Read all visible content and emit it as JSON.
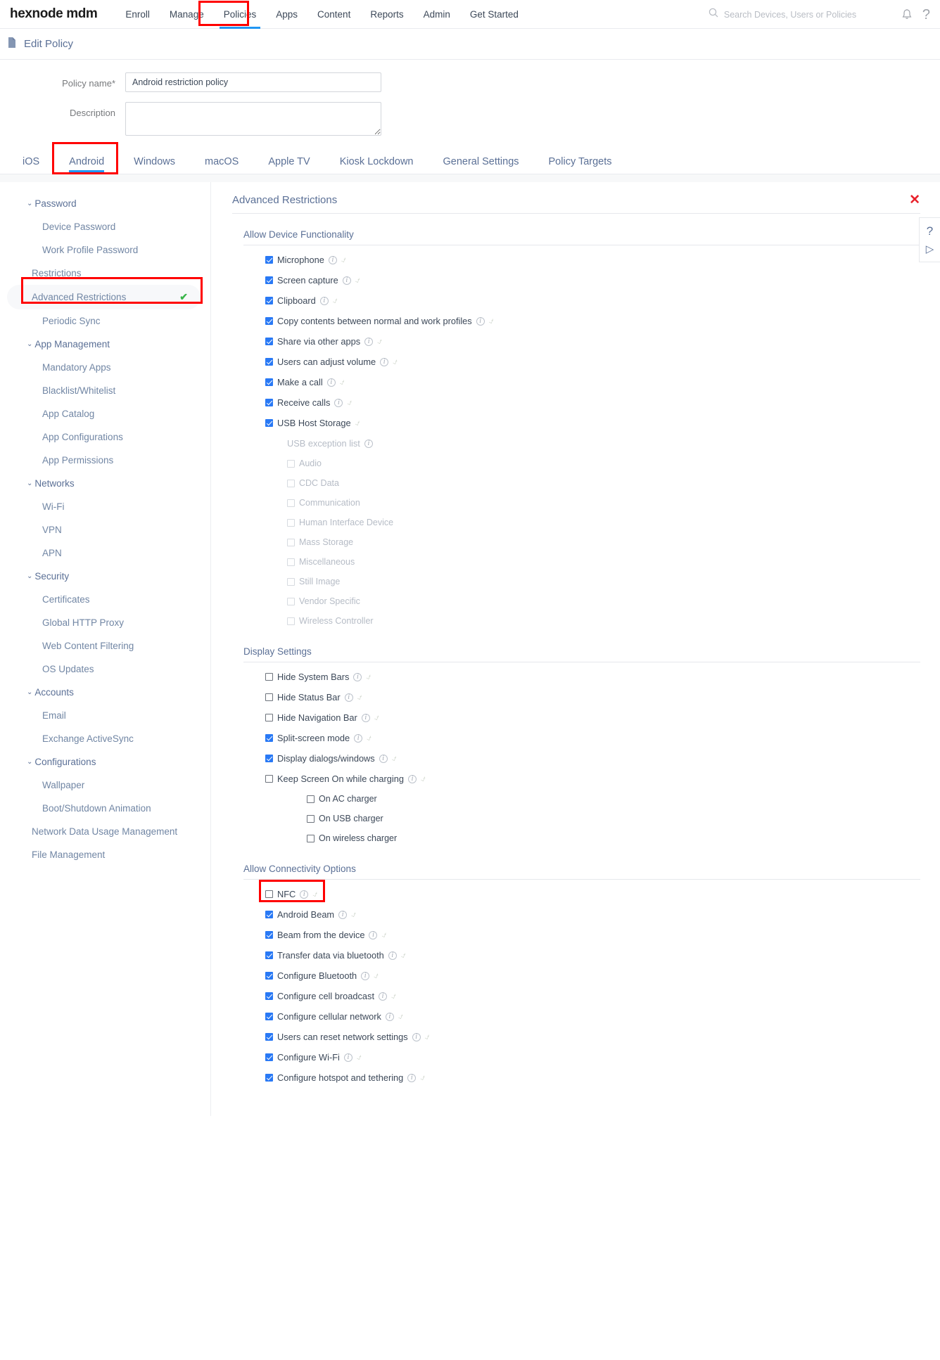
{
  "topnav": {
    "brand": "hexnode mdm",
    "items": [
      {
        "label": "Enroll"
      },
      {
        "label": "Manage"
      },
      {
        "label": "Policies"
      },
      {
        "label": "Apps"
      },
      {
        "label": "Content"
      },
      {
        "label": "Reports"
      },
      {
        "label": "Admin"
      },
      {
        "label": "Get Started"
      }
    ],
    "active": "Policies",
    "search_placeholder": "Search Devices, Users or Policies",
    "bell_icon": "bell-icon",
    "help_icon": "question-mark-icon",
    "search_icon": "search-icon"
  },
  "pageheader": {
    "icon": "document-icon",
    "title": "Edit Policy"
  },
  "form": {
    "policy_name_label": "Policy name",
    "policy_name_required": "*",
    "policy_name_value": "Android restriction policy",
    "policy_name_placeholder": "",
    "description_label": "Description",
    "description_value": "",
    "description_placeholder": ""
  },
  "platform_tabs": {
    "items": [
      "iOS",
      "Android",
      "Windows",
      "macOS",
      "Apple TV",
      "Kiosk Lockdown",
      "General Settings",
      "Policy Targets"
    ],
    "active": "Android"
  },
  "sidebar": {
    "groups": [
      {
        "type": "group",
        "label": "Password",
        "expanded": true,
        "children": [
          "Device Password",
          "Work Profile Password"
        ]
      },
      {
        "type": "group",
        "label": "Restrictions",
        "expanded": false,
        "plain": true,
        "children": [
          "Advanced Restrictions",
          "Periodic Sync"
        ]
      },
      {
        "type": "group",
        "label": "App Management",
        "expanded": true,
        "children": [
          "Mandatory Apps",
          "Blacklist/Whitelist",
          "App Catalog",
          "App Configurations",
          "App Permissions"
        ]
      },
      {
        "type": "group",
        "label": "Networks",
        "expanded": true,
        "children": [
          "Wi-Fi",
          "VPN",
          "APN"
        ]
      },
      {
        "type": "group",
        "label": "Security",
        "expanded": true,
        "children": [
          "Certificates",
          "Global HTTP Proxy",
          "Web Content Filtering",
          "OS Updates"
        ]
      },
      {
        "type": "group",
        "label": "Accounts",
        "expanded": true,
        "children": [
          "Email",
          "Exchange ActiveSync"
        ]
      },
      {
        "type": "group",
        "label": "Configurations",
        "expanded": true,
        "children": [
          "Wallpaper",
          "Boot/Shutdown Animation"
        ]
      }
    ],
    "standalone": [
      "Network Data Usage Management",
      "File Management"
    ],
    "selected": "Advanced Restrictions",
    "selected_check": "✔"
  },
  "panel": {
    "title": "Advanced Restrictions",
    "close_icon": "close-icon",
    "close_glyph": "✕",
    "help_rail": {
      "question": "?",
      "play": "▷"
    }
  },
  "sections": [
    {
      "heading": "Allow Device Functionality",
      "options": [
        {
          "label": "Microphone",
          "checked": true,
          "info": true,
          "tick": true,
          "level": 0
        },
        {
          "label": "Screen capture",
          "checked": true,
          "info": true,
          "tick": true,
          "level": 0
        },
        {
          "label": "Clipboard",
          "checked": true,
          "info": true,
          "tick": true,
          "level": 0
        },
        {
          "label": "Copy contents between normal and work profiles",
          "checked": true,
          "info": true,
          "tick": true,
          "level": 0
        },
        {
          "label": "Share via other apps",
          "checked": true,
          "info": true,
          "tick": true,
          "level": 0
        },
        {
          "label": "Users can adjust volume",
          "checked": true,
          "info": true,
          "tick": true,
          "level": 0
        },
        {
          "label": "Make a call",
          "checked": true,
          "info": true,
          "tick": true,
          "level": 0
        },
        {
          "label": "Receive calls",
          "checked": true,
          "info": true,
          "tick": true,
          "level": 0
        },
        {
          "label": "USB Host Storage",
          "checked": true,
          "info": false,
          "tick": true,
          "level": 0
        },
        {
          "label": "USB exception list",
          "checkbox": false,
          "info": true,
          "tick": false,
          "level": 1,
          "dim": true
        },
        {
          "label": "Audio",
          "checked": false,
          "info": false,
          "tick": false,
          "level": 2,
          "dim": true
        },
        {
          "label": "CDC Data",
          "checked": false,
          "info": false,
          "tick": false,
          "level": 2,
          "dim": true
        },
        {
          "label": "Communication",
          "checked": false,
          "info": false,
          "tick": false,
          "level": 2,
          "dim": true
        },
        {
          "label": "Human Interface Device",
          "checked": false,
          "info": false,
          "tick": false,
          "level": 2,
          "dim": true
        },
        {
          "label": "Mass Storage",
          "checked": false,
          "info": false,
          "tick": false,
          "level": 2,
          "dim": true
        },
        {
          "label": "Miscellaneous",
          "checked": false,
          "info": false,
          "tick": false,
          "level": 2,
          "dim": true
        },
        {
          "label": "Still Image",
          "checked": false,
          "info": false,
          "tick": false,
          "level": 2,
          "dim": true
        },
        {
          "label": "Vendor Specific",
          "checked": false,
          "info": false,
          "tick": false,
          "level": 2,
          "dim": true
        },
        {
          "label": "Wireless Controller",
          "checked": false,
          "info": false,
          "tick": false,
          "level": 2,
          "dim": true
        }
      ]
    },
    {
      "heading": "Display Settings",
      "options": [
        {
          "label": "Hide System Bars",
          "checked": false,
          "info": true,
          "tick": true,
          "level": 0
        },
        {
          "label": "Hide Status Bar",
          "checked": false,
          "info": true,
          "tick": true,
          "level": 0
        },
        {
          "label": "Hide Navigation Bar",
          "checked": false,
          "info": true,
          "tick": true,
          "level": 0
        },
        {
          "label": "Split-screen mode",
          "checked": true,
          "info": true,
          "tick": true,
          "level": 0
        },
        {
          "label": "Display dialogs/windows",
          "checked": true,
          "info": true,
          "tick": true,
          "level": 0
        },
        {
          "label": "Keep Screen On while charging",
          "checked": false,
          "info": true,
          "tick": true,
          "level": 0
        },
        {
          "label": "On AC charger",
          "checked": false,
          "info": false,
          "tick": false,
          "level": 3
        },
        {
          "label": "On USB charger",
          "checked": false,
          "info": false,
          "tick": false,
          "level": 3
        },
        {
          "label": "On wireless charger",
          "checked": false,
          "info": false,
          "tick": false,
          "level": 3
        }
      ]
    },
    {
      "heading": "Allow Connectivity Options",
      "options": [
        {
          "label": "NFC",
          "checked": false,
          "info": true,
          "tick": true,
          "level": 0,
          "highlight": true
        },
        {
          "label": "Android Beam",
          "checked": true,
          "info": true,
          "tick": true,
          "level": 0
        },
        {
          "label": "Beam from the device",
          "checked": true,
          "info": true,
          "tick": true,
          "level": 0
        },
        {
          "label": "Transfer data via bluetooth",
          "checked": true,
          "info": true,
          "tick": true,
          "level": 0
        },
        {
          "label": "Configure Bluetooth",
          "checked": true,
          "info": true,
          "tick": true,
          "level": 0
        },
        {
          "label": "Configure cell broadcast",
          "checked": true,
          "info": true,
          "tick": true,
          "level": 0
        },
        {
          "label": "Configure cellular network",
          "checked": true,
          "info": true,
          "tick": true,
          "level": 0
        },
        {
          "label": "Users can reset network settings",
          "checked": true,
          "info": true,
          "tick": true,
          "level": 0
        },
        {
          "label": "Configure Wi-Fi",
          "checked": true,
          "info": true,
          "tick": true,
          "level": 0
        },
        {
          "label": "Configure hotspot and tethering",
          "checked": true,
          "info": true,
          "tick": true,
          "level": 0
        }
      ]
    }
  ],
  "colors": {
    "accent": "#2196f3",
    "checkbox_on": "#2979f5",
    "highlight_box": "#ff0000",
    "close_red": "#e8212b",
    "check_green": "#3ab54a",
    "text": "#5b7096"
  }
}
